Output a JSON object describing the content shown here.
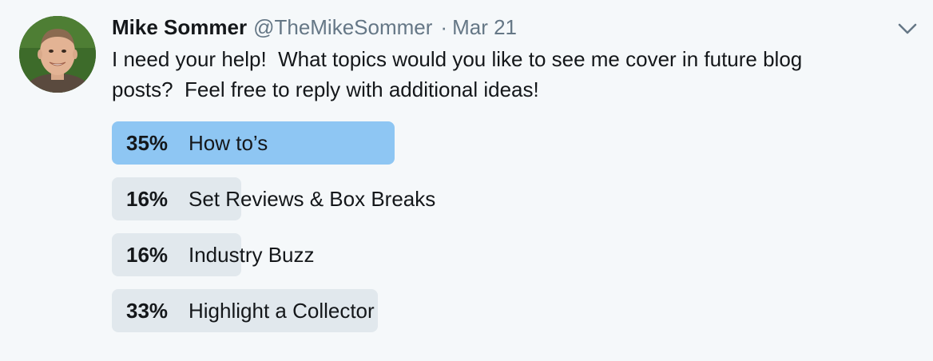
{
  "tweet": {
    "author_name": "Mike Sommer",
    "author_handle": "@TheMikeSommer",
    "separator": "·",
    "date": "Mar 21",
    "text": "I need your help!  What topics would you like to see me cover in future blog\nposts?  Feel free to reply with additional ideas!",
    "menu_icon": "chevron-down-icon",
    "avatar_icon": "avatar"
  },
  "poll": {
    "options": [
      {
        "percent_label": "35%",
        "label": "How to’s",
        "percent": 35,
        "leader": true
      },
      {
        "percent_label": "16%",
        "label": "Set Reviews & Box Breaks",
        "percent": 16,
        "leader": false
      },
      {
        "percent_label": "16%",
        "label": "Industry Buzz",
        "percent": 16,
        "leader": false
      },
      {
        "percent_label": "33%",
        "label": "Highlight a Collector",
        "percent": 33,
        "leader": false
      }
    ]
  },
  "colors": {
    "background": "#f5f8fa",
    "leader_bar": "#8ec6f3",
    "bar": "#e1e8ed",
    "muted_text": "#657786",
    "text": "#14171a"
  }
}
